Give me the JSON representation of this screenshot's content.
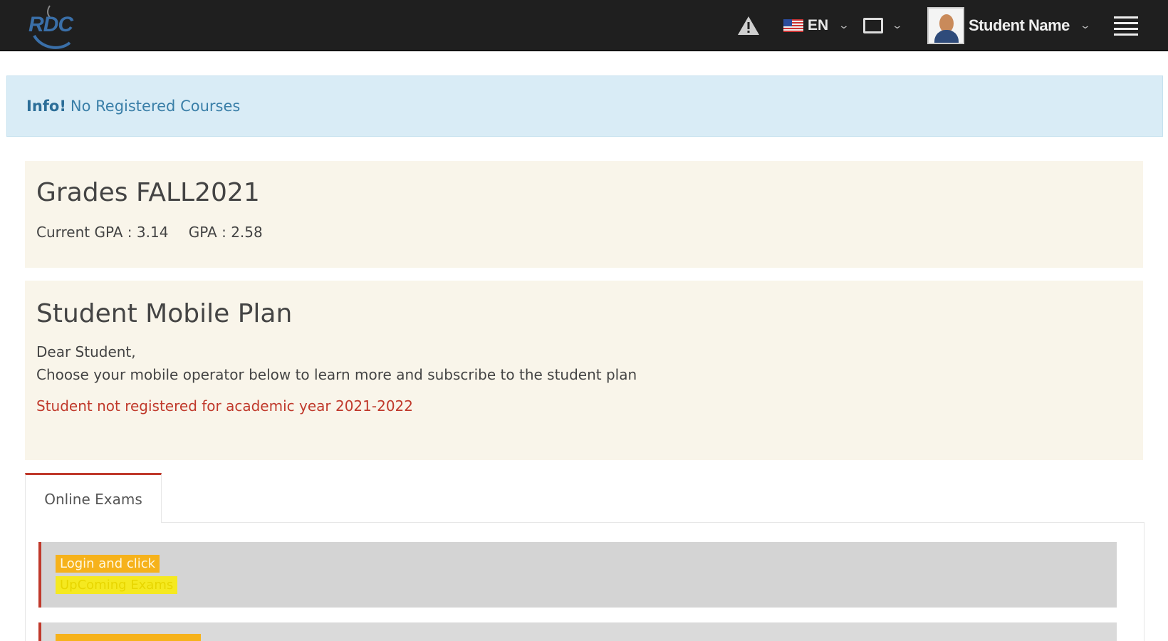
{
  "header": {
    "logo_text": "RDC",
    "language": "EN",
    "user_name": "Student Name"
  },
  "alert": {
    "label": "Info!",
    "message": "No Registered Courses"
  },
  "grades": {
    "title": "Grades FALL2021",
    "current_gpa": "Current GPA : 3.14",
    "gpa": "GPA : 2.58"
  },
  "mobile_plan": {
    "title": "Student Mobile Plan",
    "greeting": "Dear Student,",
    "instruction": "Choose your mobile operator below to learn more and subscribe to the student plan",
    "error": "Student not registered for academic year 2021-2022"
  },
  "tabs": [
    {
      "label": "Online Exams"
    }
  ],
  "exam_cards": [
    {
      "line1": "Login and click",
      "line2": "UpComing Exams"
    }
  ],
  "colors": {
    "topbar": "#1f1f1f",
    "info_bg": "#d9ecf6",
    "panel_bg": "#f9f5ea",
    "error": "#c0392b",
    "accent": "#c0392b"
  },
  "icons": [
    "warning-icon",
    "us-flag-icon",
    "chevron-down-icon",
    "screen-icon",
    "avatar",
    "hamburger-menu-icon"
  ]
}
